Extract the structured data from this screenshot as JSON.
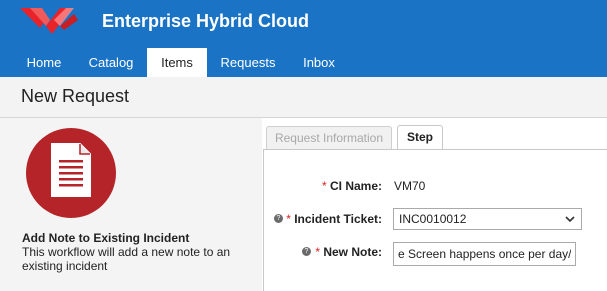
{
  "header": {
    "app_title": "Enterprise Hybrid Cloud",
    "brand_color": "#1a73c4"
  },
  "nav": {
    "items": [
      {
        "label": "Home"
      },
      {
        "label": "Catalog"
      },
      {
        "label": "Items",
        "active": true
      },
      {
        "label": "Requests"
      },
      {
        "label": "Inbox"
      }
    ]
  },
  "page": {
    "title": "New Request"
  },
  "workflow": {
    "icon": "document-icon",
    "icon_color": "#b42428",
    "name": "Add Note to Existing Incident",
    "description": "This workflow will add a new note to an existing incident"
  },
  "tabs": [
    {
      "label": "Request Information",
      "active": false
    },
    {
      "label": "Step",
      "active": true
    }
  ],
  "form": {
    "required_marker": "*",
    "ci_name": {
      "label": "CI Name:",
      "value": "VM70"
    },
    "incident_ticket": {
      "label": "Incident Ticket:",
      "value": "INC0010012"
    },
    "new_note": {
      "label": "New Note:",
      "value": "e Screen happens once per day/"
    }
  }
}
